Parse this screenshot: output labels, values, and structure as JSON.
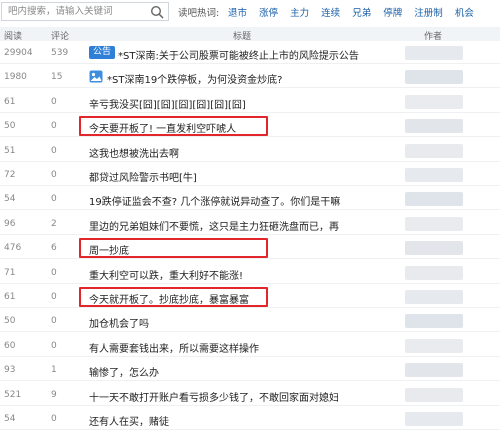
{
  "search": {
    "placeholder": "吧内搜索，请输入关键词"
  },
  "hot_label": "读吧热词:",
  "hot_words": [
    "退市",
    "涨停",
    "主力",
    "连续",
    "兄弟",
    "停牌",
    "注册制",
    "机会"
  ],
  "columns": {
    "reads": "阅读",
    "comments": "评论",
    "title": "标题",
    "author": "作者"
  },
  "rows": [
    {
      "reads": "29904",
      "comments": "539",
      "badge": "公告",
      "title": "*ST深南:关于公司股票可能被终止上市的风险提示公告",
      "highlight": false
    },
    {
      "reads": "1980",
      "comments": "15",
      "icon": "image-icon",
      "title": "*ST深南19个跌停板，为何没资金炒底?",
      "highlight": false
    },
    {
      "reads": "61",
      "comments": "0",
      "title": "辛亏我没买[囧][囧][囧][囧][囧][囧]",
      "highlight": false
    },
    {
      "reads": "50",
      "comments": "0",
      "title": "今天要开板了! 一直发利空吓唬人",
      "highlight": true
    },
    {
      "reads": "51",
      "comments": "0",
      "title": "这我也想被洗出去啊",
      "highlight": false
    },
    {
      "reads": "72",
      "comments": "0",
      "title": "都贷过风险警示书吧[牛]",
      "highlight": false
    },
    {
      "reads": "54",
      "comments": "0",
      "title": "19跌停证监会不查? 几个涨停就说异动查了。你们是干嘛",
      "highlight": false
    },
    {
      "reads": "96",
      "comments": "2",
      "title": "里边的兄弟姐妹们不要慌，这只是主力狂砸洗盘而已，再",
      "highlight": false
    },
    {
      "reads": "476",
      "comments": "6",
      "title": "周一抄底",
      "highlight": true
    },
    {
      "reads": "71",
      "comments": "0",
      "title": "重大利空可以跌，重大利好不能涨!",
      "highlight": false
    },
    {
      "reads": "61",
      "comments": "0",
      "title": "今天就开板了。抄底抄底，暴富暴富",
      "highlight": true
    },
    {
      "reads": "50",
      "comments": "0",
      "title": "加仓机会了吗",
      "highlight": false
    },
    {
      "reads": "60",
      "comments": "0",
      "title": "有人需要套钱出来，所以需要这样操作",
      "highlight": false
    },
    {
      "reads": "93",
      "comments": "1",
      "title": "输惨了，怎么办",
      "highlight": false
    },
    {
      "reads": "521",
      "comments": "9",
      "title": "十一天不敢打开账户看亏损多少钱了，不敢回家面对媳妇",
      "highlight": false
    },
    {
      "reads": "54",
      "comments": "0",
      "title": "还有人在买，赌徒",
      "highlight": false
    }
  ],
  "colors": {
    "accent": "#1a5fa8",
    "highlight": "#e3262c",
    "badge": "#2f7fd8"
  }
}
